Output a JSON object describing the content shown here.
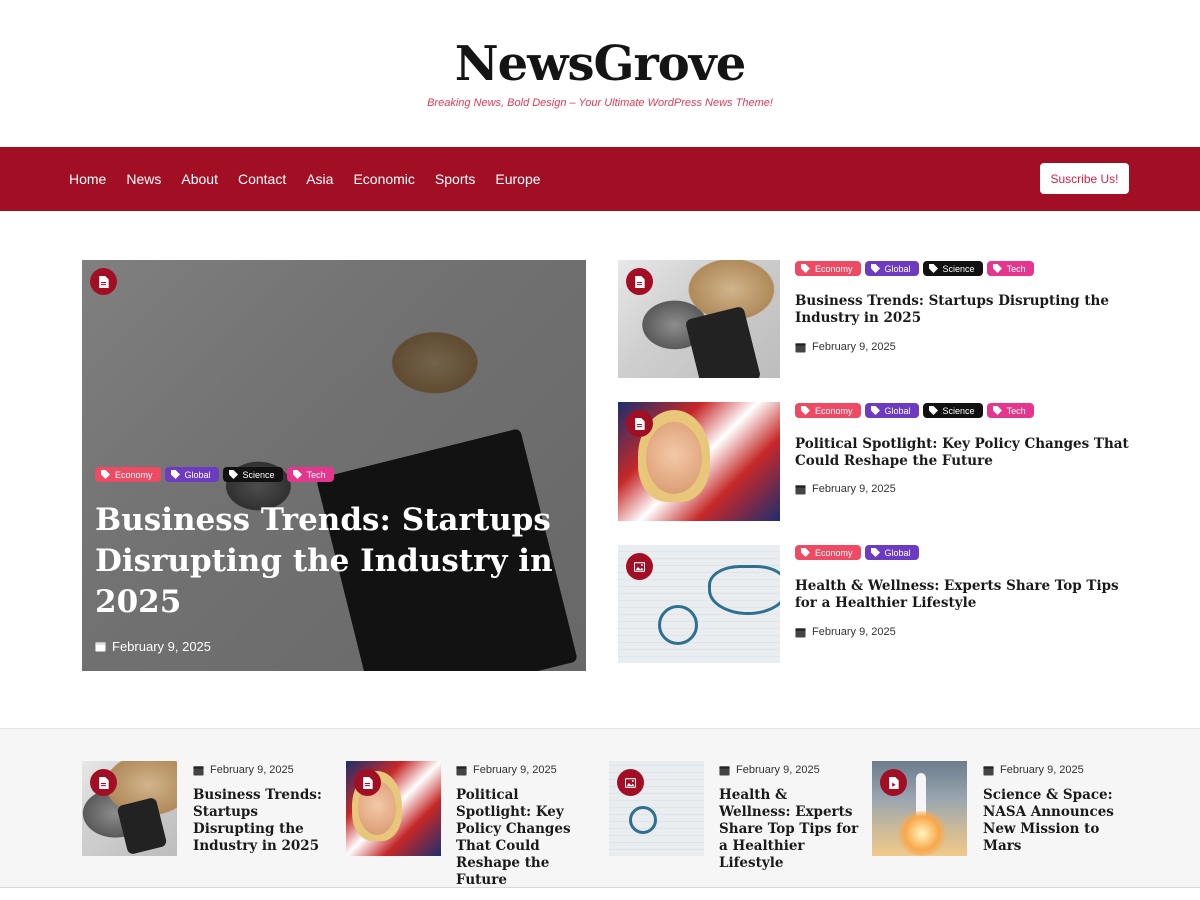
{
  "site": {
    "title": "NewsGrove",
    "tagline": "Breaking News, Bold Design – Your Ultimate WordPress News Theme!"
  },
  "nav": {
    "items": [
      "Home",
      "News",
      "About",
      "Contact",
      "Asia",
      "Economic",
      "Sports",
      "Europe"
    ],
    "subscribe_label": "Suscribe Us!"
  },
  "colors": {
    "brand": "#a20f25",
    "tagline": "#e33a56",
    "tag_economy": "#ef4a63",
    "tag_global": "#6c3bc2",
    "tag_science": "#111111",
    "tag_tech": "#e6358c"
  },
  "hero": {
    "type_icon": "document-icon",
    "tags": [
      "Economy",
      "Global",
      "Science",
      "Tech"
    ],
    "title": "Business Trends: Startups Disrupting the Industry in 2025",
    "date": "February 9, 2025"
  },
  "side_posts": [
    {
      "type_icon": "document-icon",
      "tags": [
        "Economy",
        "Global",
        "Science",
        "Tech"
      ],
      "title": "Business Trends: Startups Disrupting the Industry in 2025",
      "date": "February 9, 2025"
    },
    {
      "type_icon": "document-icon",
      "tags": [
        "Economy",
        "Global",
        "Science",
        "Tech"
      ],
      "title": "Political Spotlight: Key Policy Changes That Could Reshape the Future",
      "date": "February 9, 2025"
    },
    {
      "type_icon": "image-icon",
      "tags": [
        "Economy",
        "Global"
      ],
      "title": "Health & Wellness: Experts Share Top Tips for a Healthier Lifestyle",
      "date": "February 9, 2025"
    }
  ],
  "strip_posts": [
    {
      "type_icon": "document-icon",
      "title": "Business Trends: Startups Disrupting the Industry in 2025",
      "date": "February 9, 2025"
    },
    {
      "type_icon": "document-icon",
      "title": "Political Spotlight: Key Policy Changes That Could Reshape the Future",
      "date": "February 9, 2025"
    },
    {
      "type_icon": "image-icon",
      "title": "Health & Wellness: Experts Share Top Tips for a Healthier Lifestyle",
      "date": "February 9, 2025"
    },
    {
      "type_icon": "video-file-icon",
      "title": "Science & Space: NASA Announces New Mission to Mars",
      "date": "February 9, 2025"
    }
  ]
}
